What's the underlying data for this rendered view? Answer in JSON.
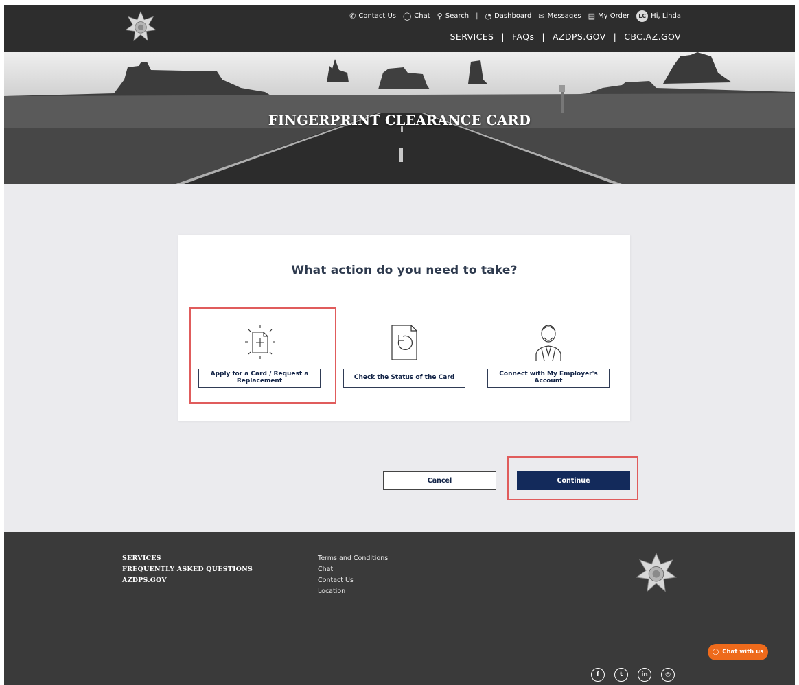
{
  "header": {
    "util_nav": [
      {
        "icon": "phone-icon",
        "label": "Contact Us"
      },
      {
        "icon": "chat-icon",
        "label": "Chat"
      },
      {
        "icon": "search-icon",
        "label": "Search"
      },
      {
        "icon": "dashboard-icon",
        "label": "Dashboard"
      },
      {
        "icon": "mail-icon",
        "label": "Messages"
      },
      {
        "icon": "order-icon",
        "label": "My Order"
      }
    ],
    "separator": "|",
    "avatar_initials": "LC",
    "greeting": "Hi, Linda",
    "main_nav": [
      "SERVICES",
      "FAQs",
      "AZDPS.GOV",
      "CBC.AZ.GOV"
    ]
  },
  "hero": {
    "title": "FINGERPRINT CLEARANCE CARD"
  },
  "card": {
    "title": "What action do you need to take?",
    "options": [
      {
        "icon": "new-document-icon",
        "label": "Apply for a Card / Request a Replacement"
      },
      {
        "icon": "document-refresh-icon",
        "label": "Check the Status of the Card"
      },
      {
        "icon": "employer-person-icon",
        "label": "Connect with My Employer's Account"
      }
    ]
  },
  "actions": {
    "cancel": "Cancel",
    "continue": "Continue"
  },
  "footer": {
    "col1": [
      "SERVICES",
      "FREQUENTLY ASKED QUESTIONS",
      "AZDPS.GOV"
    ],
    "col2": [
      "Terms and Conditions",
      "Chat",
      "Contact Us",
      "Location"
    ],
    "social": [
      {
        "icon": "facebook-icon",
        "glyph": "f"
      },
      {
        "icon": "twitter-icon",
        "glyph": "t"
      },
      {
        "icon": "linkedin-icon",
        "glyph": "in"
      },
      {
        "icon": "instagram-icon",
        "glyph": "◎"
      }
    ],
    "chat_label": "Chat with us"
  },
  "colors": {
    "primary": "#132a5b",
    "highlight": "#e05c5c",
    "chat": "#ee6a1b",
    "header_bg": "#2d2d2d",
    "footer_bg": "#3a3a3a"
  }
}
